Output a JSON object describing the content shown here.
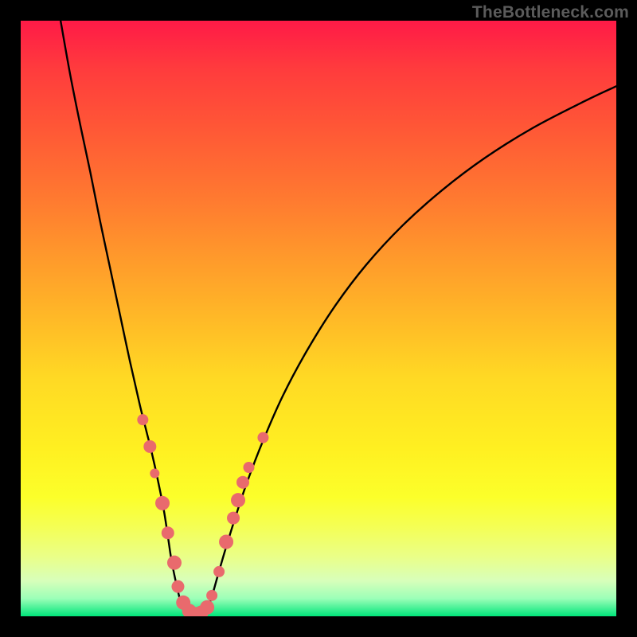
{
  "watermark": "TheBottleneck.com",
  "colors": {
    "frame": "#000000",
    "curve": "#000000",
    "markerFill": "#e96a6d",
    "markerStroke": "#cf5558"
  },
  "chart_data": {
    "type": "line",
    "title": "",
    "xlabel": "",
    "ylabel": "",
    "xlim": [
      0,
      100
    ],
    "ylim": [
      0,
      100
    ],
    "grid": false,
    "series": [
      {
        "name": "left-branch",
        "x": [
          6.7,
          8.3,
          10.0,
          11.7,
          13.3,
          15.0,
          16.7,
          18.3,
          20.0,
          21.0,
          22.0,
          23.0,
          24.0,
          24.7,
          25.3,
          26.0,
          26.7,
          27.3
        ],
        "y": [
          100.0,
          91.0,
          82.5,
          74.5,
          66.5,
          58.5,
          50.5,
          43.0,
          35.5,
          31.5,
          27.5,
          23.0,
          18.0,
          13.5,
          9.5,
          6.0,
          3.0,
          1.2
        ]
      },
      {
        "name": "valley-floor",
        "x": [
          27.3,
          28.0,
          28.7,
          29.3,
          30.0,
          30.7,
          31.3
        ],
        "y": [
          1.2,
          0.5,
          0.3,
          0.3,
          0.3,
          0.5,
          1.2
        ]
      },
      {
        "name": "right-branch",
        "x": [
          31.3,
          32.0,
          33.0,
          34.3,
          36.0,
          38.0,
          40.7,
          44.0,
          48.0,
          52.7,
          58.0,
          64.0,
          70.7,
          78.0,
          86.0,
          94.7,
          100.0
        ],
        "y": [
          1.2,
          3.0,
          6.5,
          11.0,
          16.5,
          22.5,
          29.5,
          37.0,
          44.5,
          52.0,
          59.0,
          65.5,
          71.5,
          77.0,
          82.0,
          86.5,
          89.0
        ]
      }
    ],
    "markers": [
      {
        "x": 20.5,
        "y": 33.0,
        "r": 7
      },
      {
        "x": 21.7,
        "y": 28.5,
        "r": 8
      },
      {
        "x": 22.5,
        "y": 24.0,
        "r": 6
      },
      {
        "x": 23.8,
        "y": 19.0,
        "r": 9
      },
      {
        "x": 24.7,
        "y": 14.0,
        "r": 8
      },
      {
        "x": 25.8,
        "y": 9.0,
        "r": 9
      },
      {
        "x": 26.4,
        "y": 5.0,
        "r": 8
      },
      {
        "x": 27.3,
        "y": 2.3,
        "r": 9
      },
      {
        "x": 28.3,
        "y": 0.9,
        "r": 9
      },
      {
        "x": 29.3,
        "y": 0.5,
        "r": 8
      },
      {
        "x": 30.3,
        "y": 0.6,
        "r": 9
      },
      {
        "x": 31.3,
        "y": 1.5,
        "r": 9
      },
      {
        "x": 32.1,
        "y": 3.5,
        "r": 7
      },
      {
        "x": 33.3,
        "y": 7.5,
        "r": 7
      },
      {
        "x": 34.5,
        "y": 12.5,
        "r": 9
      },
      {
        "x": 35.7,
        "y": 16.5,
        "r": 8
      },
      {
        "x": 36.5,
        "y": 19.5,
        "r": 9
      },
      {
        "x": 37.3,
        "y": 22.5,
        "r": 8
      },
      {
        "x": 38.3,
        "y": 25.0,
        "r": 7
      },
      {
        "x": 40.7,
        "y": 30.0,
        "r": 7
      }
    ]
  }
}
